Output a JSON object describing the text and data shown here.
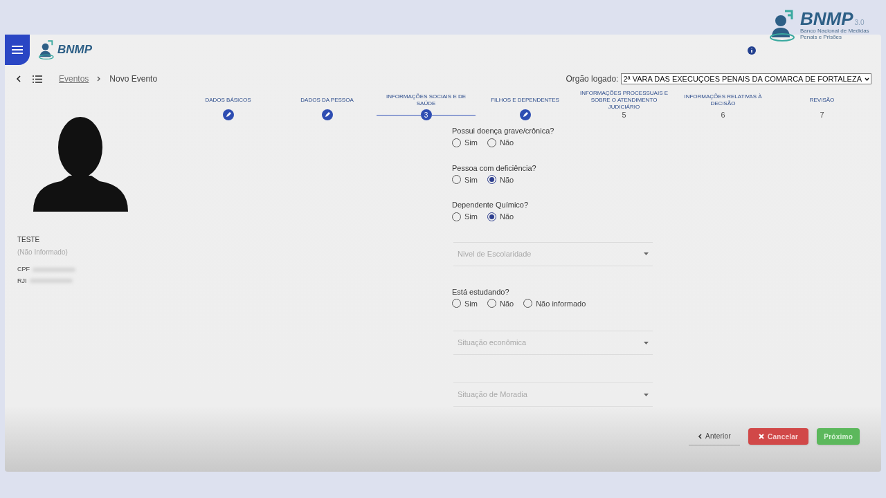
{
  "logo_small": {
    "title": "BNMP"
  },
  "logo_large": {
    "title": "BNMP",
    "version": "3.0",
    "subtitle": "Banco Nacional de Medidas Penais e Prisões"
  },
  "breadcrumb": [
    {
      "label": "Eventos",
      "kind": "link"
    },
    {
      "label": "Novo Evento",
      "kind": "current"
    }
  ],
  "orgao": {
    "label": "Orgão logado:",
    "value": "2ª VARA DAS EXECUÇOES PENAIS DA COMARCA DE FORTALEZA"
  },
  "person": {
    "name": "TESTE",
    "subtitle": "(Não Informado)",
    "fields": [
      {
        "label": "CPF"
      },
      {
        "label": "RJI"
      }
    ]
  },
  "steps": [
    {
      "label": "DADOS BÁSICOS",
      "kind": "done"
    },
    {
      "label": "DADOS DA PESSOA",
      "kind": "done"
    },
    {
      "label": "INFORMAÇÕES SOCIAIS E DE SAÚDE",
      "kind": "current",
      "number": "3"
    },
    {
      "label": "FILHOS E DEPENDENTES",
      "kind": "done"
    },
    {
      "label": "INFORMAÇÕES PROCESSUAIS E SOBRE O ATENDIMENTO JUDICIÁRIO",
      "kind": "pending",
      "number": "5"
    },
    {
      "label": "INFORMAÇÕES RELATIVAS À DECISÃO",
      "kind": "pending",
      "number": "6"
    },
    {
      "label": "REVISÃO",
      "kind": "pending",
      "number": "7"
    }
  ],
  "form": [
    {
      "kind": "radio",
      "label": "Possui doença grave/crônica?",
      "options": [
        {
          "label": "Sim",
          "selected": false
        },
        {
          "label": "Não",
          "selected": false
        }
      ]
    },
    {
      "kind": "radio",
      "label": "Pessoa com deficiência?",
      "options": [
        {
          "label": "Sim",
          "selected": false
        },
        {
          "label": "Não",
          "selected": true
        }
      ]
    },
    {
      "kind": "radio",
      "label": "Dependente Químico?",
      "options": [
        {
          "label": "Sim",
          "selected": false
        },
        {
          "label": "Não",
          "selected": true
        }
      ]
    },
    {
      "kind": "select",
      "placeholder": "Nivel de Escolaridade"
    },
    {
      "kind": "radio",
      "label": "Está estudando?",
      "options": [
        {
          "label": "Sim",
          "selected": false
        },
        {
          "label": "Não",
          "selected": false
        },
        {
          "label": "Não informado",
          "selected": false
        }
      ]
    },
    {
      "kind": "select",
      "placeholder": "Situação econômica"
    },
    {
      "kind": "select",
      "placeholder": "Situação de Moradia"
    }
  ],
  "buttons": [
    {
      "label": "Anterior",
      "kind": "back"
    },
    {
      "label": "Cancelar",
      "kind": "cancel"
    },
    {
      "label": "Próximo",
      "kind": "next"
    }
  ]
}
